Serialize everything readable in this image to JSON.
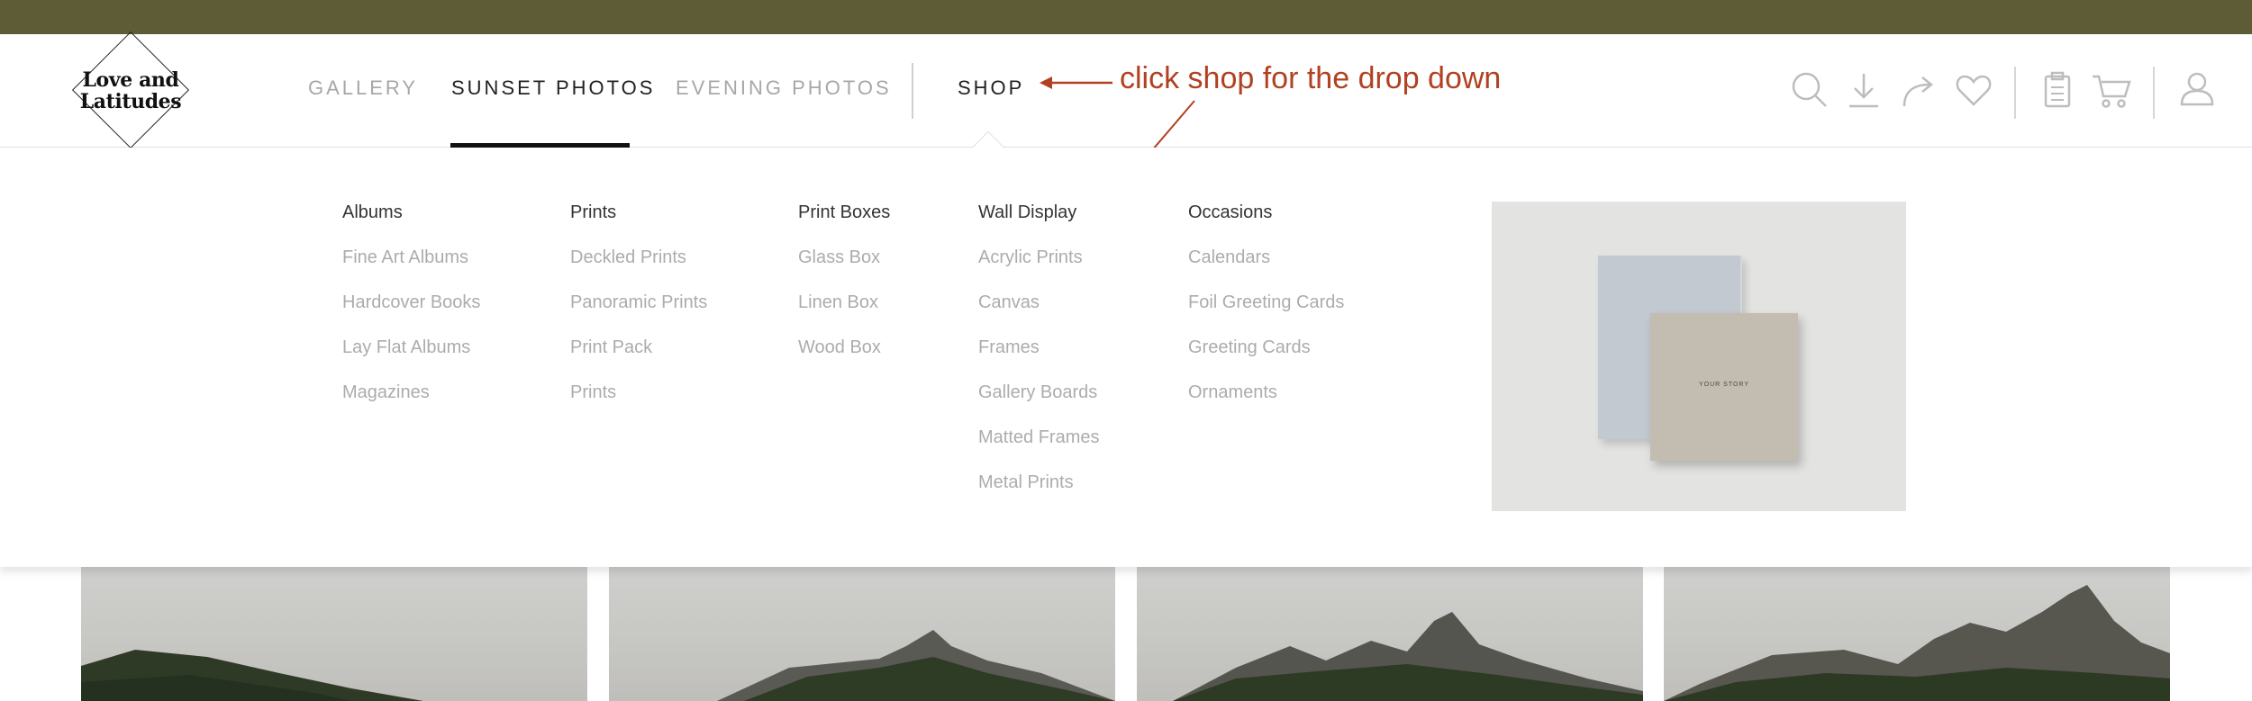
{
  "logo": {
    "line1": "Love and",
    "line2": "Latitudes"
  },
  "nav": [
    {
      "label": "GALLERY"
    },
    {
      "label": "SUNSET PHOTOS"
    },
    {
      "label": "EVENING PHOTOS"
    },
    {
      "label": "SHOP"
    }
  ],
  "annotation": {
    "text": "click shop for the drop down"
  },
  "header_icons": [
    "search-icon",
    "download-icon",
    "share-icon",
    "heart-icon",
    "clipboard-icon",
    "cart-icon",
    "user-icon"
  ],
  "dropdown": {
    "columns": [
      {
        "heading": "Albums",
        "items": [
          "Fine Art Albums",
          "Hardcover Books",
          "Lay Flat Albums",
          "Magazines"
        ]
      },
      {
        "heading": "Prints",
        "items": [
          "Deckled Prints",
          "Panoramic Prints",
          "Print Pack",
          "Prints"
        ]
      },
      {
        "heading": "Print Boxes",
        "items": [
          "Glass Box",
          "Linen Box",
          "Wood Box"
        ]
      },
      {
        "heading": "Wall Display",
        "items": [
          "Acrylic Prints",
          "Canvas",
          "Frames",
          "Gallery Boards",
          "Matted Frames",
          "Metal Prints"
        ]
      },
      {
        "heading": "Occasions",
        "items": [
          "Calendars",
          "Foil Greeting Cards",
          "Greeting Cards",
          "Ornaments"
        ]
      }
    ],
    "promo": {
      "book_title": "YOUR STORY"
    }
  },
  "colors": {
    "topbar": "#5d5c36",
    "annotation": "#b14122",
    "nav_active": "#222222",
    "nav_inactive": "#a7a7a7",
    "menu_item": "#acacac"
  }
}
